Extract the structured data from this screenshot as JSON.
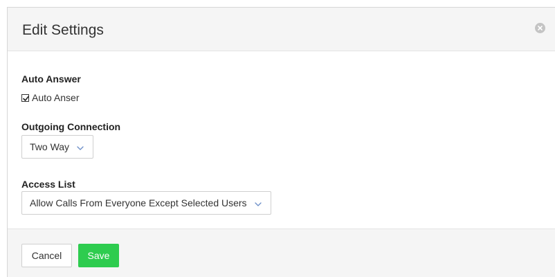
{
  "modal": {
    "title": "Edit Settings"
  },
  "auto_answer": {
    "heading": "Auto Answer",
    "checkbox_label": "Auto Anser",
    "checked": true
  },
  "outgoing_connection": {
    "heading": "Outgoing Connection",
    "selected": "Two Way"
  },
  "access_list": {
    "heading": "Access List",
    "selected": "Allow Calls From Everyone Except Selected Users"
  },
  "footer": {
    "cancel_label": "Cancel",
    "save_label": "Save"
  },
  "colors": {
    "save_button": "#2ecc4f",
    "chevron": "#6b8ec7",
    "header_bg": "#f5f5f5"
  },
  "icons": {
    "close": "close-circle-icon",
    "dropdown": "chevron-down-icon",
    "checkbox": "checkbox-checked-icon"
  }
}
